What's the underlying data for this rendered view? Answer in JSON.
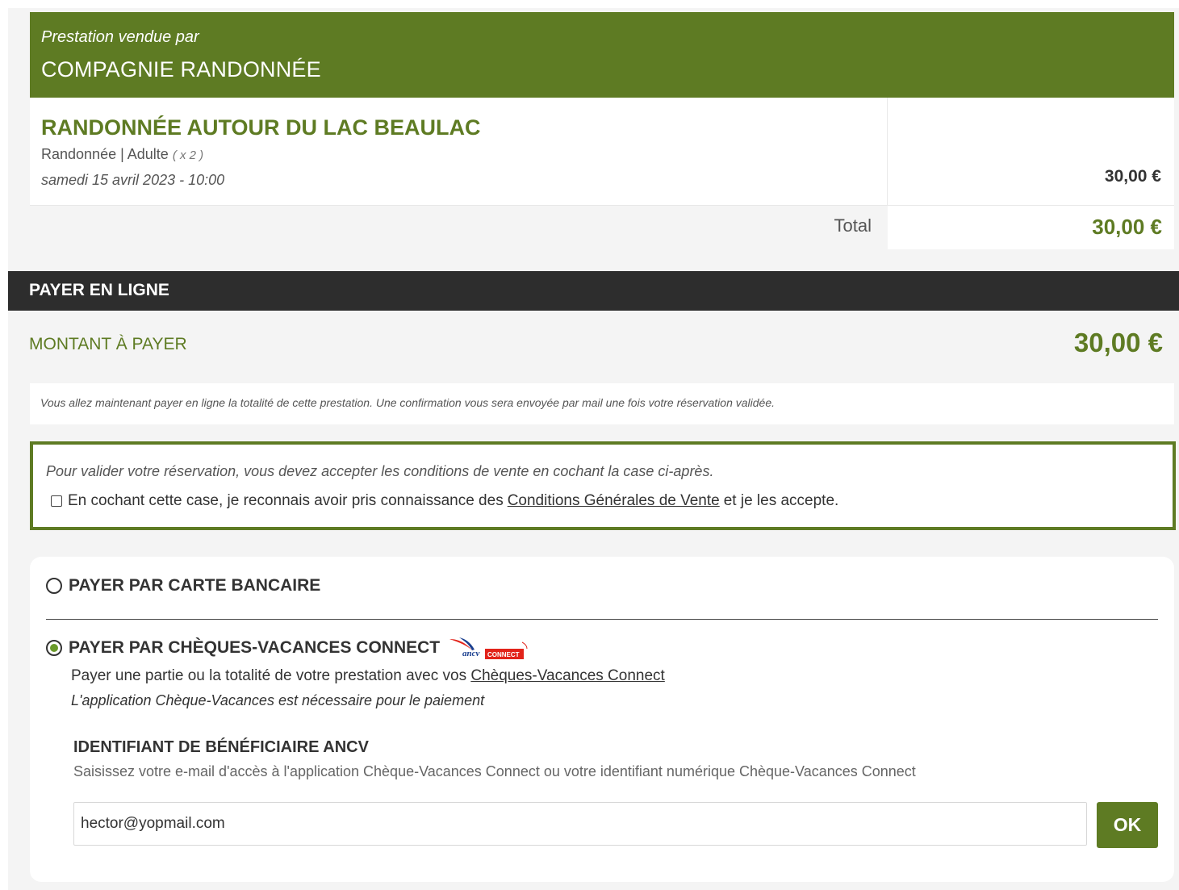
{
  "seller": {
    "sold_by_label": "Prestation vendue par",
    "name": "COMPAGNIE RANDONNÉE"
  },
  "product": {
    "title": "RANDONNÉE AUTOUR DU LAC BEAULAC",
    "category": "Randonnée | Adulte",
    "quantity": "( x 2 )",
    "date": "samedi 15 avril 2023 - 10:00",
    "price": "30,00 €"
  },
  "total": {
    "label": "Total",
    "value": "30,00 €"
  },
  "payment": {
    "section_title": "PAYER EN LIGNE",
    "amount_label": "MONTANT À PAYER",
    "amount_value": "30,00 €",
    "info_text": "Vous allez maintenant payer en ligne la totalité de cette prestation. Une confirmation vous sera envoyée par mail une fois votre réservation validée."
  },
  "conditions": {
    "hint": "Pour valider votre réservation, vous devez accepter les conditions de vente en cochant la case ci-après.",
    "checkbox_prefix": "En cochant cette case, je reconnais avoir pris connaissance des",
    "cgv_link": "Conditions Générales de Vente",
    "checkbox_suffix": "et je les accepte.",
    "checked": false
  },
  "options": {
    "card_label": "PAYER PAR CARTE BANCAIRE",
    "card_selected": false,
    "ancv_label": "PAYER PAR CHÈQUES-VACANCES CONNECT",
    "ancv_selected": true,
    "ancv_logo_text": "ancv",
    "ancv_logo_badge": "CONNECT",
    "ancv_desc_prefix": "Payer une partie ou la totalité de votre prestation avec vos",
    "ancv_desc_link": "Chèques-Vacances Connect",
    "ancv_note": "L'application Chèque-Vacances est nécessaire pour le paiement"
  },
  "beneficiary": {
    "title": "IDENTIFIANT DE BÉNÉFICIAIRE ANCV",
    "help": "Saisissez votre e-mail d'accès à l'application Chèque-Vacances Connect ou votre identifiant numérique Chèque-Vacances Connect",
    "input_value": "hector@yopmail.com",
    "ok_label": "OK"
  },
  "colors": {
    "brand_green": "#5e7b23",
    "dark_bar": "#2d2d2d",
    "radio_green": "#6a9a2a",
    "ancv_red": "#e2231a"
  }
}
